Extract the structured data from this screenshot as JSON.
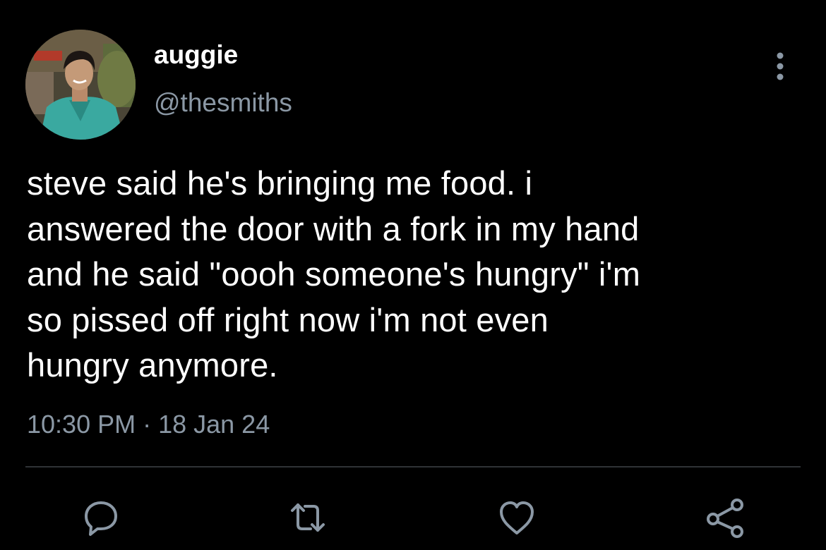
{
  "author": {
    "display_name": "auggie",
    "handle": "@thesmiths"
  },
  "tweet": {
    "lines": [
      "steve said he's bringing me food. i",
      "answered the door with a fork in my hand",
      "and he said \"oooh someone's hungry\" i'm",
      "so pissed off right now i'm not even",
      "hungry anymore."
    ],
    "time": "10:30 PM",
    "separator": " · ",
    "date": "18 Jan 24"
  },
  "icons": {
    "more": "more-vertical-icon",
    "reply": "reply-icon",
    "retweet": "retweet-icon",
    "like": "heart-icon",
    "share": "share-icon"
  },
  "colors": {
    "background": "#000000",
    "text": "#ffffff",
    "secondary_text": "#8b98a5",
    "divider": "#2f3336"
  }
}
